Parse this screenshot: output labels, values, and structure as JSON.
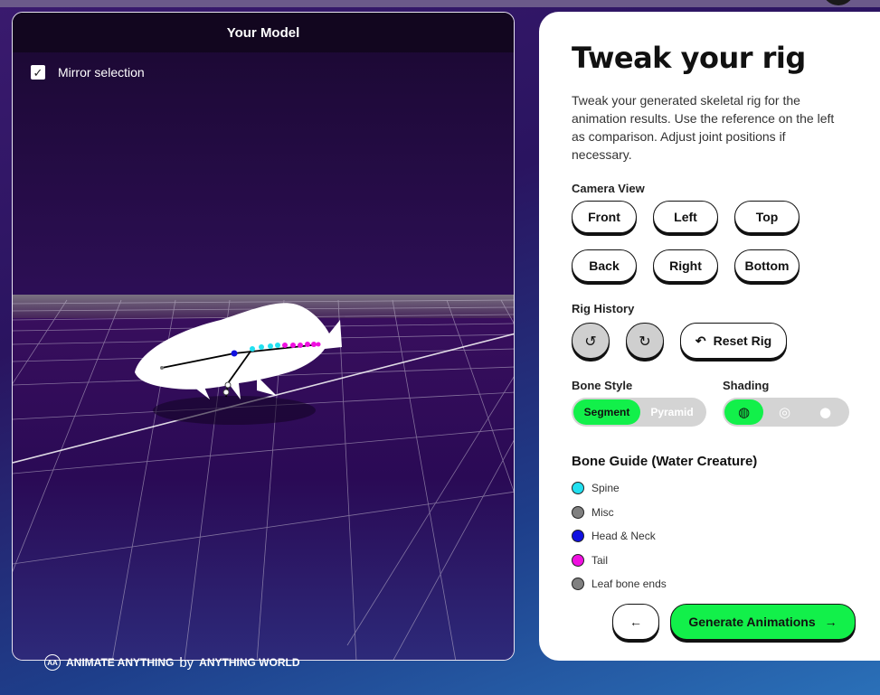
{
  "viewport": {
    "title": "Your Model",
    "mirror_label": "Mirror selection",
    "mirror_checked": true,
    "brand_name": "ANIMATE ANYTHING",
    "brand_by": "by",
    "brand_company": "ANYTHING WORLD"
  },
  "panel": {
    "title": "Tweak your rig",
    "description": "Tweak your generated skeletal rig for the animation results. Use the reference on the left as comparison. Adjust joint positions if necessary.",
    "camera_label": "Camera View",
    "camera_buttons": [
      "Front",
      "Left",
      "Top",
      "Back",
      "Right",
      "Bottom"
    ],
    "history_label": "Rig History",
    "undo_icon": "undo-icon",
    "redo_icon": "redo-icon",
    "reset_label": "Reset Rig",
    "bone_style_label": "Bone Style",
    "bone_style_options": [
      "Segment",
      "Pyramid"
    ],
    "bone_style_selected": "Segment",
    "shading_label": "Shading",
    "shading_selected": 0,
    "guide_title": "Bone Guide (Water Creature)",
    "legend": [
      {
        "label": "Spine",
        "color": "#22e0f0"
      },
      {
        "label": "Misc",
        "color": "#808080"
      },
      {
        "label": "Head & Neck",
        "color": "#1010e0"
      },
      {
        "label": "Tail",
        "color": "#f010e0"
      },
      {
        "label": "Leaf bone ends",
        "color": "#808080"
      }
    ],
    "generate_label": "Generate Animations"
  },
  "colors": {
    "accent": "#12f04a",
    "viewport_bg": "#2b0e52"
  }
}
